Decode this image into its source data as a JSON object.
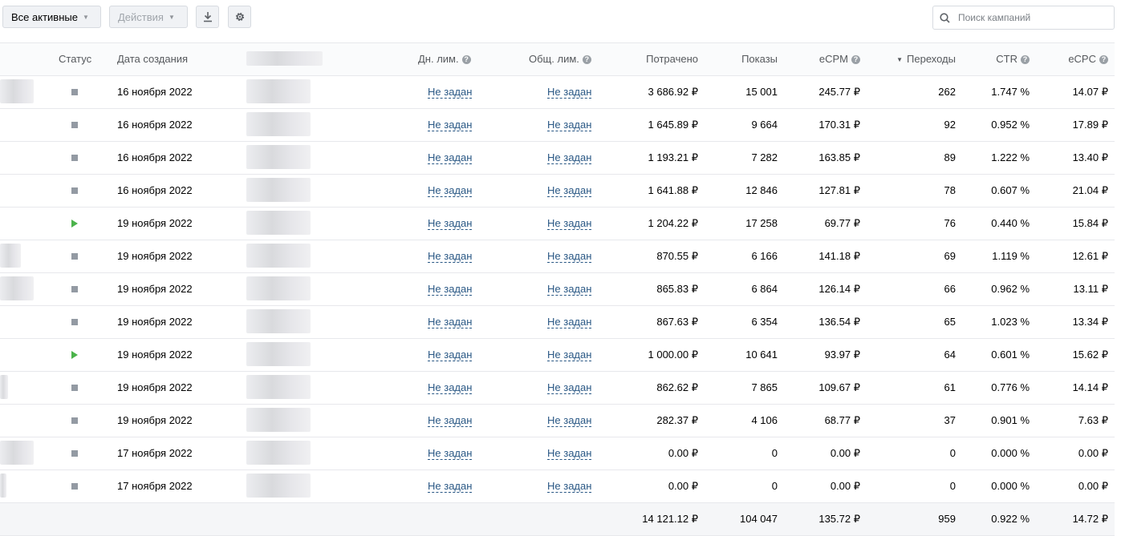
{
  "toolbar": {
    "filter_label": "Все активные",
    "actions_label": "Действия",
    "search_placeholder": "Поиск кампаний"
  },
  "columns": {
    "status": "Статус",
    "created": "Дата создания",
    "daily_limit": "Дн. лим.",
    "total_limit": "Общ. лим.",
    "spent": "Потрачено",
    "impressions": "Показы",
    "ecpm": "eCPM",
    "clicks": "Переходы",
    "ctr": "CTR",
    "ecpc": "eCPC"
  },
  "rows": [
    {
      "status": "stopped",
      "created": "16 ноября 2022",
      "daily_limit": "Не задан",
      "total_limit": "Не задан",
      "spent": "3 686.92 ₽",
      "impressions": "15 001",
      "ecpm": "245.77 ₽",
      "clicks": "262",
      "ctr": "1.747 %",
      "ecpc": "14.07 ₽"
    },
    {
      "status": "stopped",
      "created": "16 ноября 2022",
      "daily_limit": "Не задан",
      "total_limit": "Не задан",
      "spent": "1 645.89 ₽",
      "impressions": "9 664",
      "ecpm": "170.31 ₽",
      "clicks": "92",
      "ctr": "0.952 %",
      "ecpc": "17.89 ₽"
    },
    {
      "status": "stopped",
      "created": "16 ноября 2022",
      "daily_limit": "Не задан",
      "total_limit": "Не задан",
      "spent": "1 193.21 ₽",
      "impressions": "7 282",
      "ecpm": "163.85 ₽",
      "clicks": "89",
      "ctr": "1.222 %",
      "ecpc": "13.40 ₽"
    },
    {
      "status": "stopped",
      "created": "16 ноября 2022",
      "daily_limit": "Не задан",
      "total_limit": "Не задан",
      "spent": "1 641.88 ₽",
      "impressions": "12 846",
      "ecpm": "127.81 ₽",
      "clicks": "78",
      "ctr": "0.607 %",
      "ecpc": "21.04 ₽"
    },
    {
      "status": "running",
      "created": "19 ноября 2022",
      "daily_limit": "Не задан",
      "total_limit": "Не задан",
      "spent": "1 204.22 ₽",
      "impressions": "17 258",
      "ecpm": "69.77 ₽",
      "clicks": "76",
      "ctr": "0.440 %",
      "ecpc": "15.84 ₽"
    },
    {
      "status": "stopped",
      "created": "19 ноября 2022",
      "daily_limit": "Не задан",
      "total_limit": "Не задан",
      "spent": "870.55 ₽",
      "impressions": "6 166",
      "ecpm": "141.18 ₽",
      "clicks": "69",
      "ctr": "1.119 %",
      "ecpc": "12.61 ₽"
    },
    {
      "status": "stopped",
      "created": "19 ноября 2022",
      "daily_limit": "Не задан",
      "total_limit": "Не задан",
      "spent": "865.83 ₽",
      "impressions": "6 864",
      "ecpm": "126.14 ₽",
      "clicks": "66",
      "ctr": "0.962 %",
      "ecpc": "13.11 ₽"
    },
    {
      "status": "stopped",
      "created": "19 ноября 2022",
      "daily_limit": "Не задан",
      "total_limit": "Не задан",
      "spent": "867.63 ₽",
      "impressions": "6 354",
      "ecpm": "136.54 ₽",
      "clicks": "65",
      "ctr": "1.023 %",
      "ecpc": "13.34 ₽"
    },
    {
      "status": "running",
      "created": "19 ноября 2022",
      "daily_limit": "Не задан",
      "total_limit": "Не задан",
      "spent": "1 000.00 ₽",
      "impressions": "10 641",
      "ecpm": "93.97 ₽",
      "clicks": "64",
      "ctr": "0.601 %",
      "ecpc": "15.62 ₽"
    },
    {
      "status": "stopped",
      "created": "19 ноября 2022",
      "daily_limit": "Не задан",
      "total_limit": "Не задан",
      "spent": "862.62 ₽",
      "impressions": "7 865",
      "ecpm": "109.67 ₽",
      "clicks": "61",
      "ctr": "0.776 %",
      "ecpc": "14.14 ₽"
    },
    {
      "status": "stopped",
      "created": "19 ноября 2022",
      "daily_limit": "Не задан",
      "total_limit": "Не задан",
      "spent": "282.37 ₽",
      "impressions": "4 106",
      "ecpm": "68.77 ₽",
      "clicks": "37",
      "ctr": "0.901 %",
      "ecpc": "7.63 ₽"
    },
    {
      "status": "stopped",
      "created": "17 ноября 2022",
      "daily_limit": "Не задан",
      "total_limit": "Не задан",
      "spent": "0.00 ₽",
      "impressions": "0",
      "ecpm": "0.00 ₽",
      "clicks": "0",
      "ctr": "0.000 %",
      "ecpc": "0.00 ₽"
    },
    {
      "status": "stopped",
      "created": "17 ноября 2022",
      "daily_limit": "Не задан",
      "total_limit": "Не задан",
      "spent": "0.00 ₽",
      "impressions": "0",
      "ecpm": "0.00 ₽",
      "clicks": "0",
      "ctr": "0.000 %",
      "ecpc": "0.00 ₽"
    }
  ],
  "totals": {
    "spent": "14 121.12 ₽",
    "impressions": "104 047",
    "ecpm": "135.72 ₽",
    "clicks": "959",
    "ctr": "0.922 %",
    "ecpc": "14.72 ₽"
  },
  "colors": {
    "link": "#2a5885",
    "status_running": "#4bb34b",
    "status_stopped": "#939aa3"
  }
}
